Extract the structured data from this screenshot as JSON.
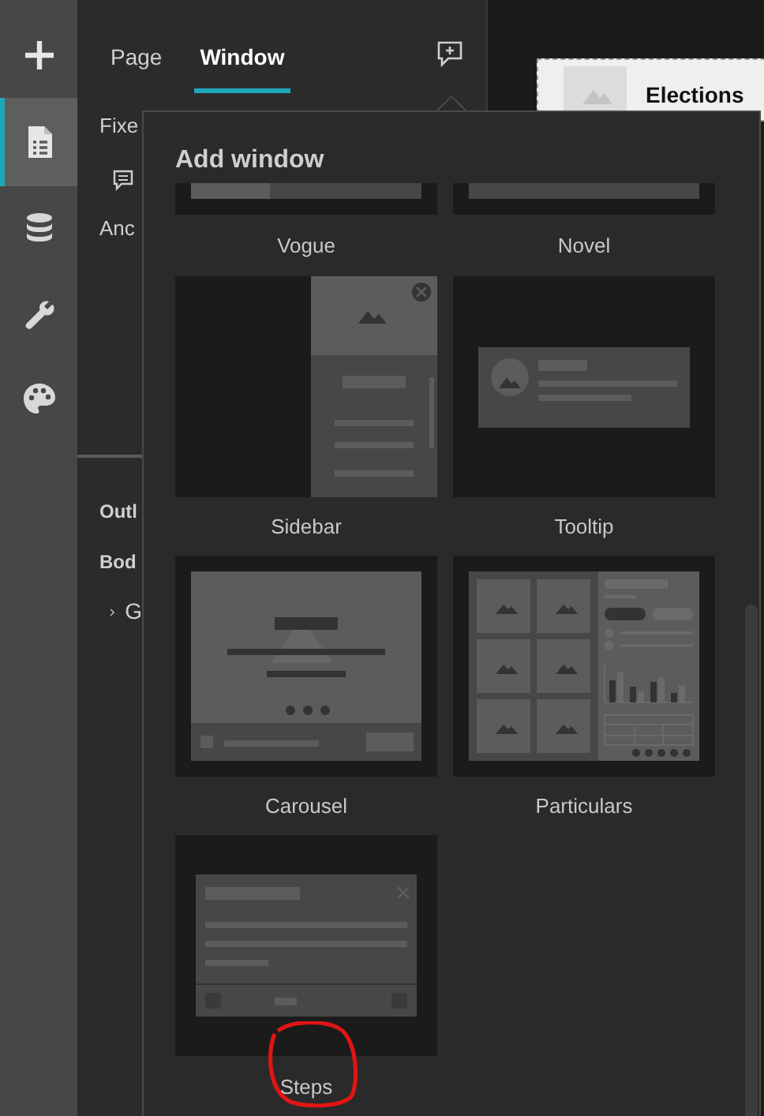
{
  "rail": {
    "items": [
      {
        "kind": "add",
        "selected": false
      },
      {
        "kind": "pages",
        "selected": true
      },
      {
        "kind": "data",
        "selected": false
      },
      {
        "kind": "tools",
        "selected": false
      },
      {
        "kind": "theme",
        "selected": false
      }
    ]
  },
  "panel": {
    "tabs": [
      {
        "label": "Page",
        "selected": false
      },
      {
        "label": "Window",
        "selected": true
      }
    ],
    "items": [
      "Fixe",
      "Anc"
    ],
    "sections": [
      "Outl",
      "Bod"
    ],
    "tree": [
      {
        "label": "G",
        "expanded": false
      }
    ]
  },
  "canvas": {
    "card_title": "Elections"
  },
  "popup": {
    "title": "Add window",
    "templates": [
      {
        "label": "Vogue",
        "kind": "vogue",
        "circled": false
      },
      {
        "label": "Novel",
        "kind": "novel",
        "circled": false
      },
      {
        "label": "Sidebar",
        "kind": "sidebar",
        "circled": false
      },
      {
        "label": "Tooltip",
        "kind": "tooltip",
        "circled": false
      },
      {
        "label": "Carousel",
        "kind": "carousel",
        "circled": false
      },
      {
        "label": "Particulars",
        "kind": "particulars",
        "circled": false
      },
      {
        "label": "Steps",
        "kind": "steps",
        "circled": true
      }
    ]
  }
}
